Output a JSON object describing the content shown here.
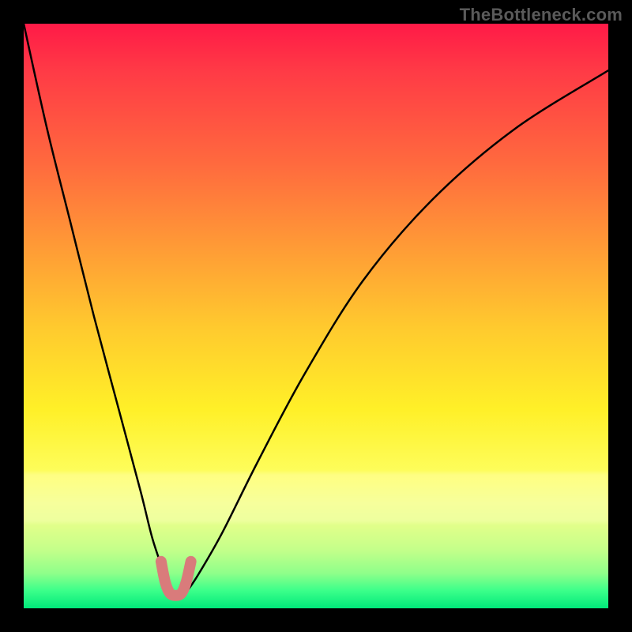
{
  "watermark": "TheBottleneck.com",
  "chart_data": {
    "type": "line",
    "title": "",
    "xlabel": "",
    "ylabel": "",
    "xlim": [
      0,
      100
    ],
    "ylim": [
      0,
      100
    ],
    "grid": false,
    "legend": false,
    "annotations": [],
    "series": [
      {
        "name": "bottleneck-curve",
        "color": "#000000",
        "x": [
          0,
          4,
          8,
          12,
          16,
          20,
          22,
          24,
          25,
          26,
          27,
          28,
          30,
          34,
          40,
          48,
          58,
          70,
          84,
          100
        ],
        "y": [
          100,
          82,
          66,
          50,
          35,
          20,
          12,
          6,
          3,
          2,
          2,
          3,
          6,
          13,
          25,
          40,
          56,
          70,
          82,
          92
        ]
      }
    ],
    "highlight_segment": {
      "name": "bottom-red-marker",
      "color": "#d97b7b",
      "x": [
        23.5,
        24.2,
        25.0,
        26.0,
        27.0,
        27.8,
        28.6
      ],
      "y": [
        8,
        4.5,
        2.6,
        2.2,
        2.6,
        4.5,
        8
      ]
    },
    "gradient_stops": [
      {
        "pos": 0,
        "color": "#ff1a47"
      },
      {
        "pos": 8,
        "color": "#ff3a46"
      },
      {
        "pos": 24,
        "color": "#ff6a3e"
      },
      {
        "pos": 38,
        "color": "#ff9a36"
      },
      {
        "pos": 52,
        "color": "#ffca2e"
      },
      {
        "pos": 66,
        "color": "#fff028"
      },
      {
        "pos": 78,
        "color": "#fdff62"
      },
      {
        "pos": 82,
        "color": "#f2ff84"
      },
      {
        "pos": 86,
        "color": "#e0ff8a"
      },
      {
        "pos": 90,
        "color": "#c4ff8a"
      },
      {
        "pos": 94,
        "color": "#8fff8a"
      },
      {
        "pos": 97,
        "color": "#3bff8a"
      },
      {
        "pos": 100,
        "color": "#00e87a"
      }
    ]
  }
}
